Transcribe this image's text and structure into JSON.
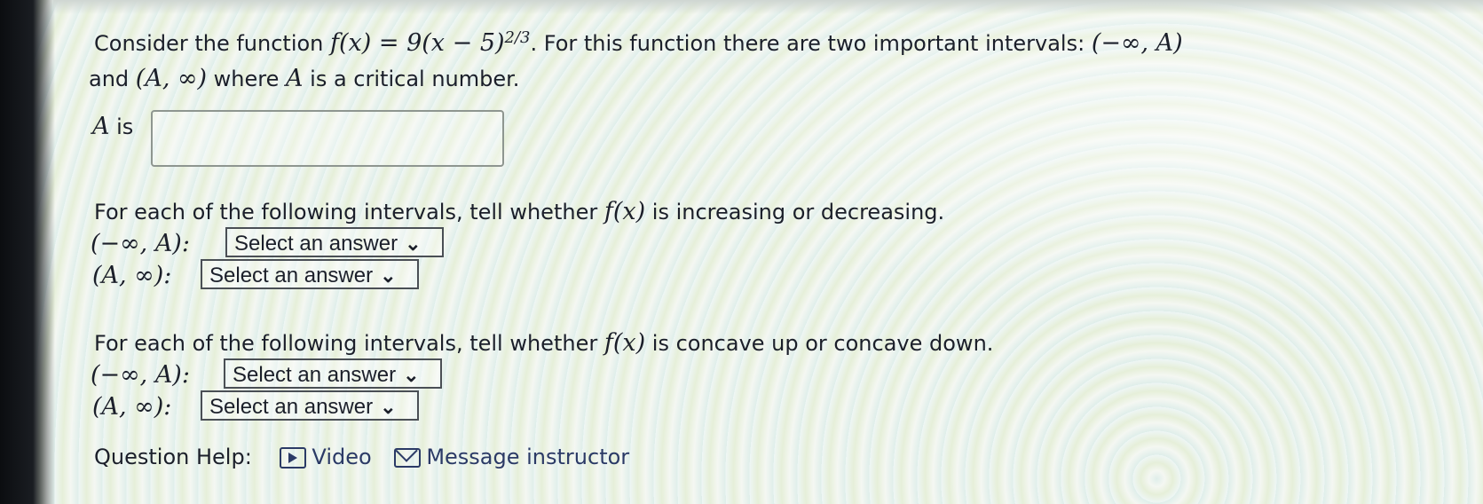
{
  "question": {
    "p1_prefix": "Consider the function",
    "p1_function": "f(x) = 9(x − 5)",
    "p1_exponent": "2/3",
    "p1_middle": ". For this function there are two important intervals:",
    "p1_interval_left": "(−∞, A)",
    "p2_and": "and",
    "p2_interval_right": "(A, ∞)",
    "p2_suffix": "where",
    "p2_var": "A",
    "p2_tail": "is a critical number.",
    "a_label_var": "A",
    "a_label_text": "is",
    "a_input_value": ""
  },
  "increasing": {
    "prompt_prefix": "For each of the following intervals, tell whether",
    "prompt_fx": "f(x)",
    "prompt_suffix": "is increasing or decreasing.",
    "row1_label": "(−∞, A):",
    "row1_select": "Select an answer",
    "row2_label": "(A, ∞):",
    "row2_select": "Select an answer"
  },
  "concavity": {
    "prompt_prefix": "For each of the following intervals, tell whether",
    "prompt_fx": "f(x)",
    "prompt_suffix": "is concave up or concave down.",
    "row1_label": "(−∞, A):",
    "row1_select": "Select an answer",
    "row2_label": "(A, ∞):",
    "row2_select": "Select an answer"
  },
  "help": {
    "label": "Question Help:",
    "video_label": "Video",
    "message_label": "Message instructor",
    "video_icon": "play-icon",
    "message_icon": "mail-icon"
  },
  "colors": {
    "link": "#2b3a66",
    "text": "#1b1f2a"
  }
}
